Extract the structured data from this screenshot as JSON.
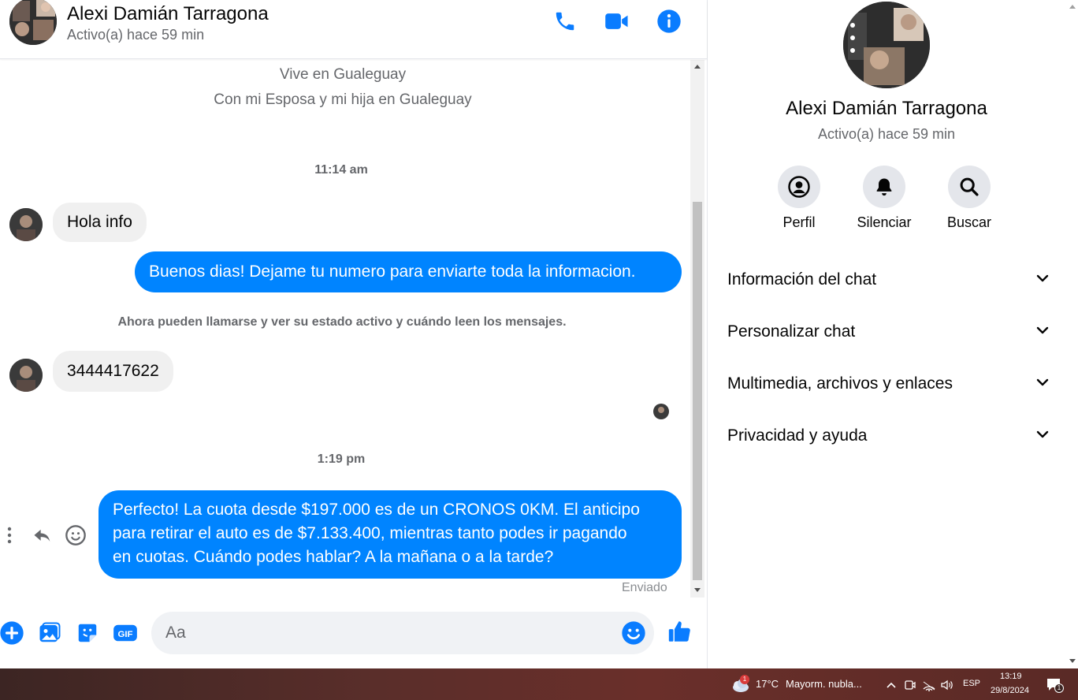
{
  "header": {
    "name": "Alexi Damián Tarragona",
    "status": "Activo(a) hace 59 min"
  },
  "conversation": {
    "profile_line_1": "Vive en Gualeguay",
    "profile_line_2": "Con mi Esposa y mi hija en Gualeguay",
    "time_1": "11:14 am",
    "msg_in_1": "Hola info",
    "msg_out_1": "Buenos dias! Dejame tu numero para enviarte toda la informacion.",
    "system_notice": "Ahora pueden llamarse y ver su estado activo y cuándo leen los mensajes.",
    "msg_in_2": "3444417622",
    "time_2": "1:19 pm",
    "msg_out_2_line_1": "Perfecto! La cuota desde $197.000 es de un CRONOS 0KM. El anticipo",
    "msg_out_2_line_2": "para retirar el auto es de $7.133.400, mientras tanto podes ir pagando",
    "msg_out_2_line_3": "en cuotas. Cuándo podes hablar? A la mañana o a la tarde?",
    "sent_status": "Enviado"
  },
  "composer": {
    "placeholder": "Aa"
  },
  "panel": {
    "name": "Alexi Damián Tarragona",
    "status": "Activo(a) hace 59 min",
    "actions": [
      {
        "label": "Perfil",
        "icon": "profile-icon"
      },
      {
        "label": "Silenciar",
        "icon": "bell-icon"
      },
      {
        "label": "Buscar",
        "icon": "search-icon"
      }
    ],
    "sections": [
      {
        "label": "Información del chat"
      },
      {
        "label": "Personalizar chat"
      },
      {
        "label": "Multimedia, archivos y enlaces"
      },
      {
        "label": "Privacidad y ayuda"
      }
    ]
  },
  "taskbar": {
    "weather_temp": "17°C",
    "weather_desc": "Mayorm. nubla...",
    "weather_badge": "1",
    "language": "ESP",
    "time": "13:19",
    "date": "29/8/2024",
    "notification_count": "1"
  },
  "colors": {
    "accent": "#0084ff",
    "bubble_in": "#f0f0f0",
    "secondary_text": "#65676b",
    "icon_blue": "#0a7cff"
  }
}
